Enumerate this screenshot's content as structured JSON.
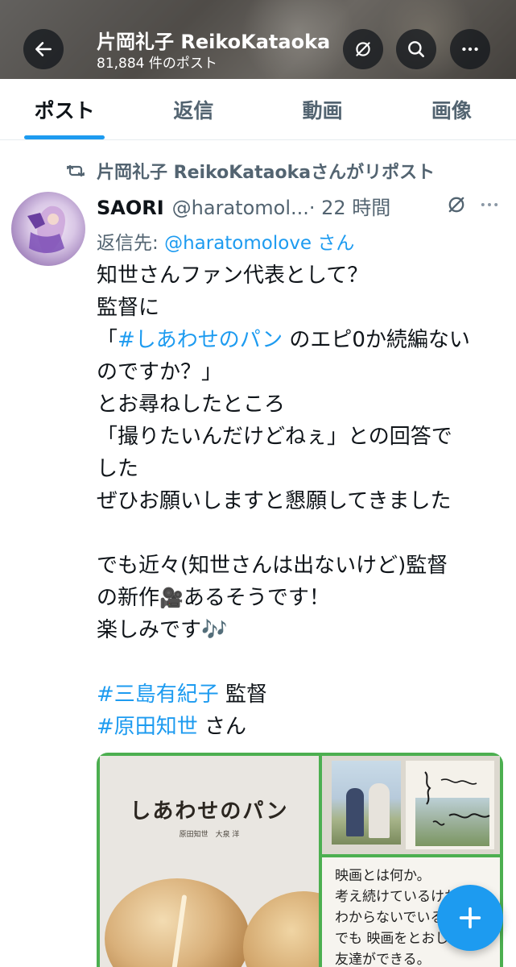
{
  "header": {
    "title": "片岡礼子 ReikoKataoka",
    "post_count": "81,884 件のポスト"
  },
  "tabs": [
    {
      "label": "ポスト",
      "active": true
    },
    {
      "label": "返信",
      "active": false
    },
    {
      "label": "動画",
      "active": false
    },
    {
      "label": "画像",
      "active": false
    }
  ],
  "post": {
    "repost_text": "片岡礼子 ReikoKataokaさんがリポスト",
    "author_name": "SAORI",
    "author_handle": "@haratomol...",
    "time": "· 22 時間",
    "reply_label": "返信先:",
    "reply_handle": "@haratomolove",
    "reply_suffix": "さん",
    "lines": {
      "l1": "知世さんファン代表として？",
      "l2": "監督に",
      "l3_pre": "「",
      "l3_tag": "#しあわせのパン",
      "l3_post": " のエピ0か続編ない",
      "l4": "のですか？」",
      "l5": "とお尋ねしたところ",
      "l6": "「撮りたいんだけどねぇ」との回答で",
      "l7": "した",
      "l8": "ぜひお願いしますと懇願してきました",
      "l9": "でも近々(知世さんは出ないけど)監督",
      "l10_pre": "の新作",
      "l10_emoji": "🎥",
      "l10_post": "あるそうです！",
      "l11": "楽しみです🎶",
      "l12_tag": "#三島有紀子",
      "l12_post": " 監督",
      "l13_tag": "#原田知世",
      "l13_post": " さん"
    },
    "media": {
      "book_title": "しあわせのパン",
      "book_sub": "原田知世　大泉 洋",
      "hand_lines": [
        "映画とは何か。",
        "考え続けているけれど、",
        "わからないでいる",
        "でも 映画をとおして",
        "友達ができる。"
      ]
    }
  },
  "icons": {
    "back": "arrow-left-icon",
    "mute": "mute-icon",
    "search": "search-icon",
    "more": "more-dots-icon",
    "repost": "repost-icon",
    "compose": "plus-icon"
  },
  "colors": {
    "accent": "#1d9bf0",
    "text": "#0f1419",
    "muted": "#536471"
  }
}
